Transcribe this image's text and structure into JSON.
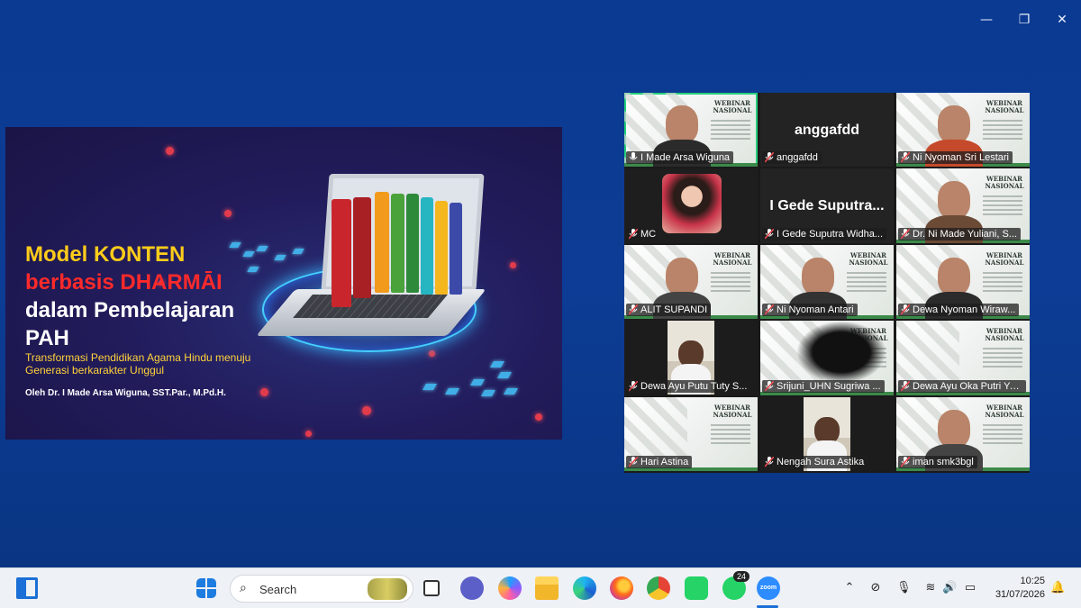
{
  "window_controls": {
    "minimize": "—",
    "restore": "❐",
    "close": "✕"
  },
  "slide": {
    "title_line1": "Model KONTEN",
    "title_line2": "berbasis DHARMĀI",
    "title_line3": "dalam Pembelajaran",
    "title_line4": "PAH",
    "subtitle_line1": "Transformasi Pendidikan Agama Hindu menuju",
    "subtitle_line2": "Generasi berkarakter Unggul",
    "author": "Oleh Dr. I Made Arsa Wiguna, SST.Par., M.Pd.H."
  },
  "webinar_label": "WEBINAR NASIONAL",
  "participants": [
    {
      "name": "I Made Arsa Wiguna",
      "muted": false,
      "active": true,
      "kind": "slide-person"
    },
    {
      "name": "anggafdd",
      "muted": true,
      "kind": "name-only",
      "display": "anggafdd"
    },
    {
      "name": "Ni Nyoman Sri Lestari",
      "muted": true,
      "kind": "slide-person"
    },
    {
      "name": "MC",
      "muted": true,
      "kind": "photo"
    },
    {
      "name": "I Gede Suputra Widha...",
      "muted": true,
      "kind": "name-only",
      "display": "I Gede Suputra..."
    },
    {
      "name": "Dr. Ni Made Yuliani, S...",
      "muted": true,
      "kind": "slide-person"
    },
    {
      "name": "ALIT SUPANDI",
      "muted": true,
      "kind": "slide-person"
    },
    {
      "name": "Ni Nyoman Antari",
      "muted": true,
      "kind": "slide-person"
    },
    {
      "name": "Dewa Nyoman Wiraw...",
      "muted": true,
      "kind": "slide-person"
    },
    {
      "name": "Dewa Ayu Putu Tuty S...",
      "muted": true,
      "kind": "room"
    },
    {
      "name": "Srijuni_UHN Sugriwa ...",
      "muted": true,
      "kind": "slide-blur"
    },
    {
      "name": "Dewa Ayu Oka Putri Ya...",
      "muted": true,
      "kind": "slide"
    },
    {
      "name": "Hari Astina",
      "muted": true,
      "kind": "slide"
    },
    {
      "name": "Nengah Sura Astika",
      "muted": true,
      "kind": "room"
    },
    {
      "name": "iman smk3bgl",
      "muted": true,
      "kind": "slide-person"
    }
  ],
  "taskbar": {
    "search_placeholder": "Search",
    "whatsapp_badge": "24",
    "zoom_label": "zoom",
    "time": "10:25",
    "date": "31/07/2026"
  },
  "colors": {
    "active_speaker": "#26d07c",
    "muted_mic": "#e5484d",
    "desktop": "#0c3c95"
  }
}
